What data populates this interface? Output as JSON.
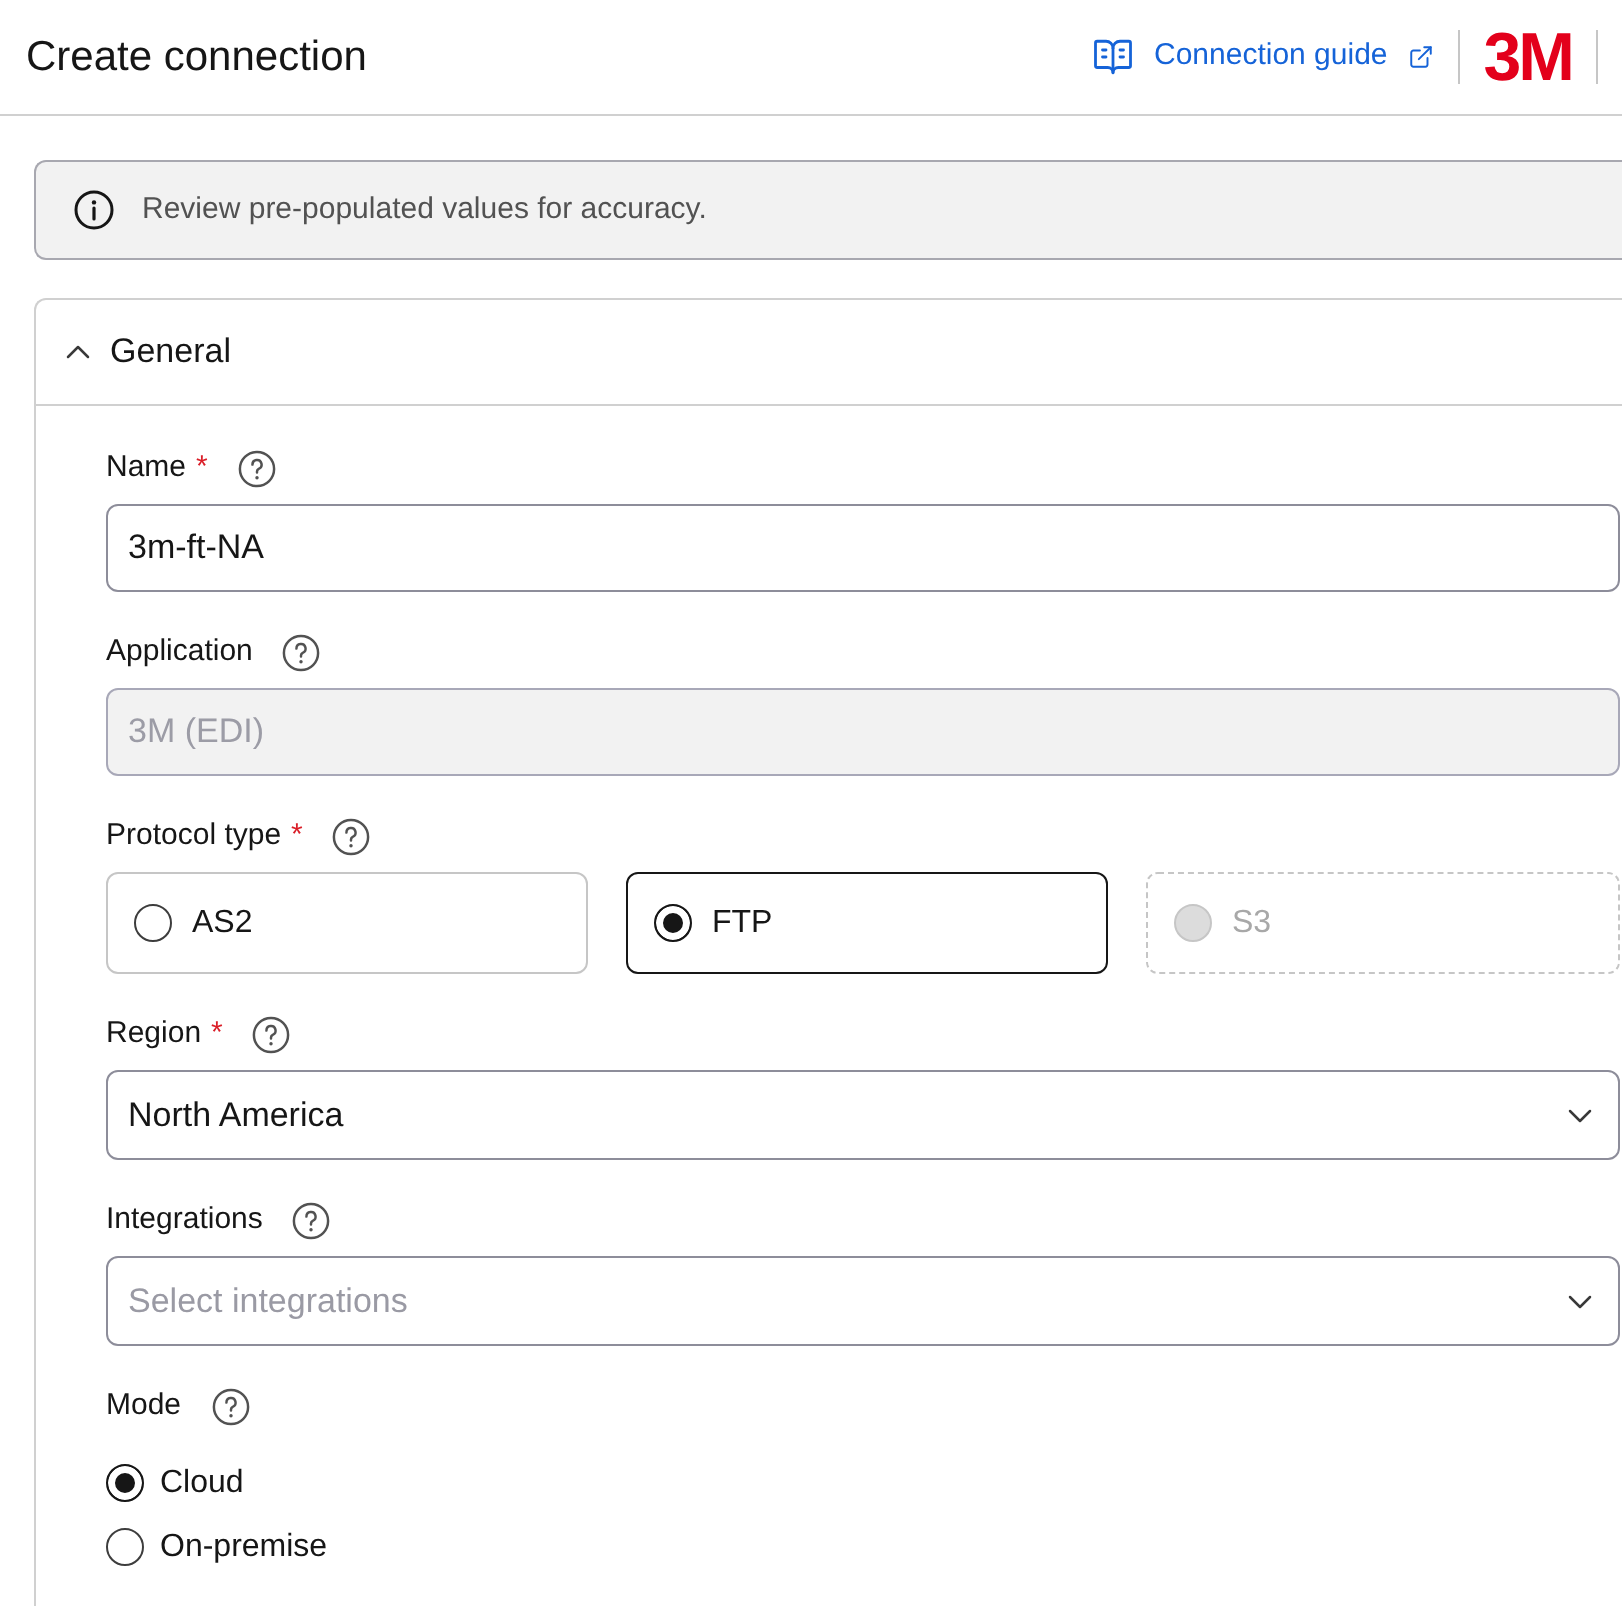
{
  "header": {
    "title": "Create connection",
    "guide_link": "Connection guide",
    "logo": "3M"
  },
  "alert": {
    "text": "Review pre-populated values for accuracy."
  },
  "section": {
    "title": "General",
    "expanded": true,
    "fields": [
      {
        "kind": "text",
        "label": "Name",
        "required_mark": "*",
        "value": "3m-ft-NA",
        "disabled": false
      },
      {
        "kind": "text",
        "label": "Application",
        "value": "3M (EDI)",
        "disabled": true
      },
      {
        "kind": "radio_cards",
        "label": "Protocol type",
        "required_mark": "*",
        "options": [
          {
            "label": "AS2",
            "selected": false,
            "disabled": false
          },
          {
            "label": "FTP",
            "selected": true,
            "disabled": false
          },
          {
            "label": "S3",
            "selected": false,
            "disabled": true
          }
        ]
      },
      {
        "kind": "select",
        "label": "Region",
        "required_mark": "*",
        "value": "North America"
      },
      {
        "kind": "select",
        "label": "Integrations",
        "placeholder": "Select integrations"
      },
      {
        "kind": "radio_list",
        "label": "Mode",
        "options": [
          {
            "label": "Cloud",
            "selected": true
          },
          {
            "label": "On-premise",
            "selected": false
          }
        ]
      }
    ]
  }
}
